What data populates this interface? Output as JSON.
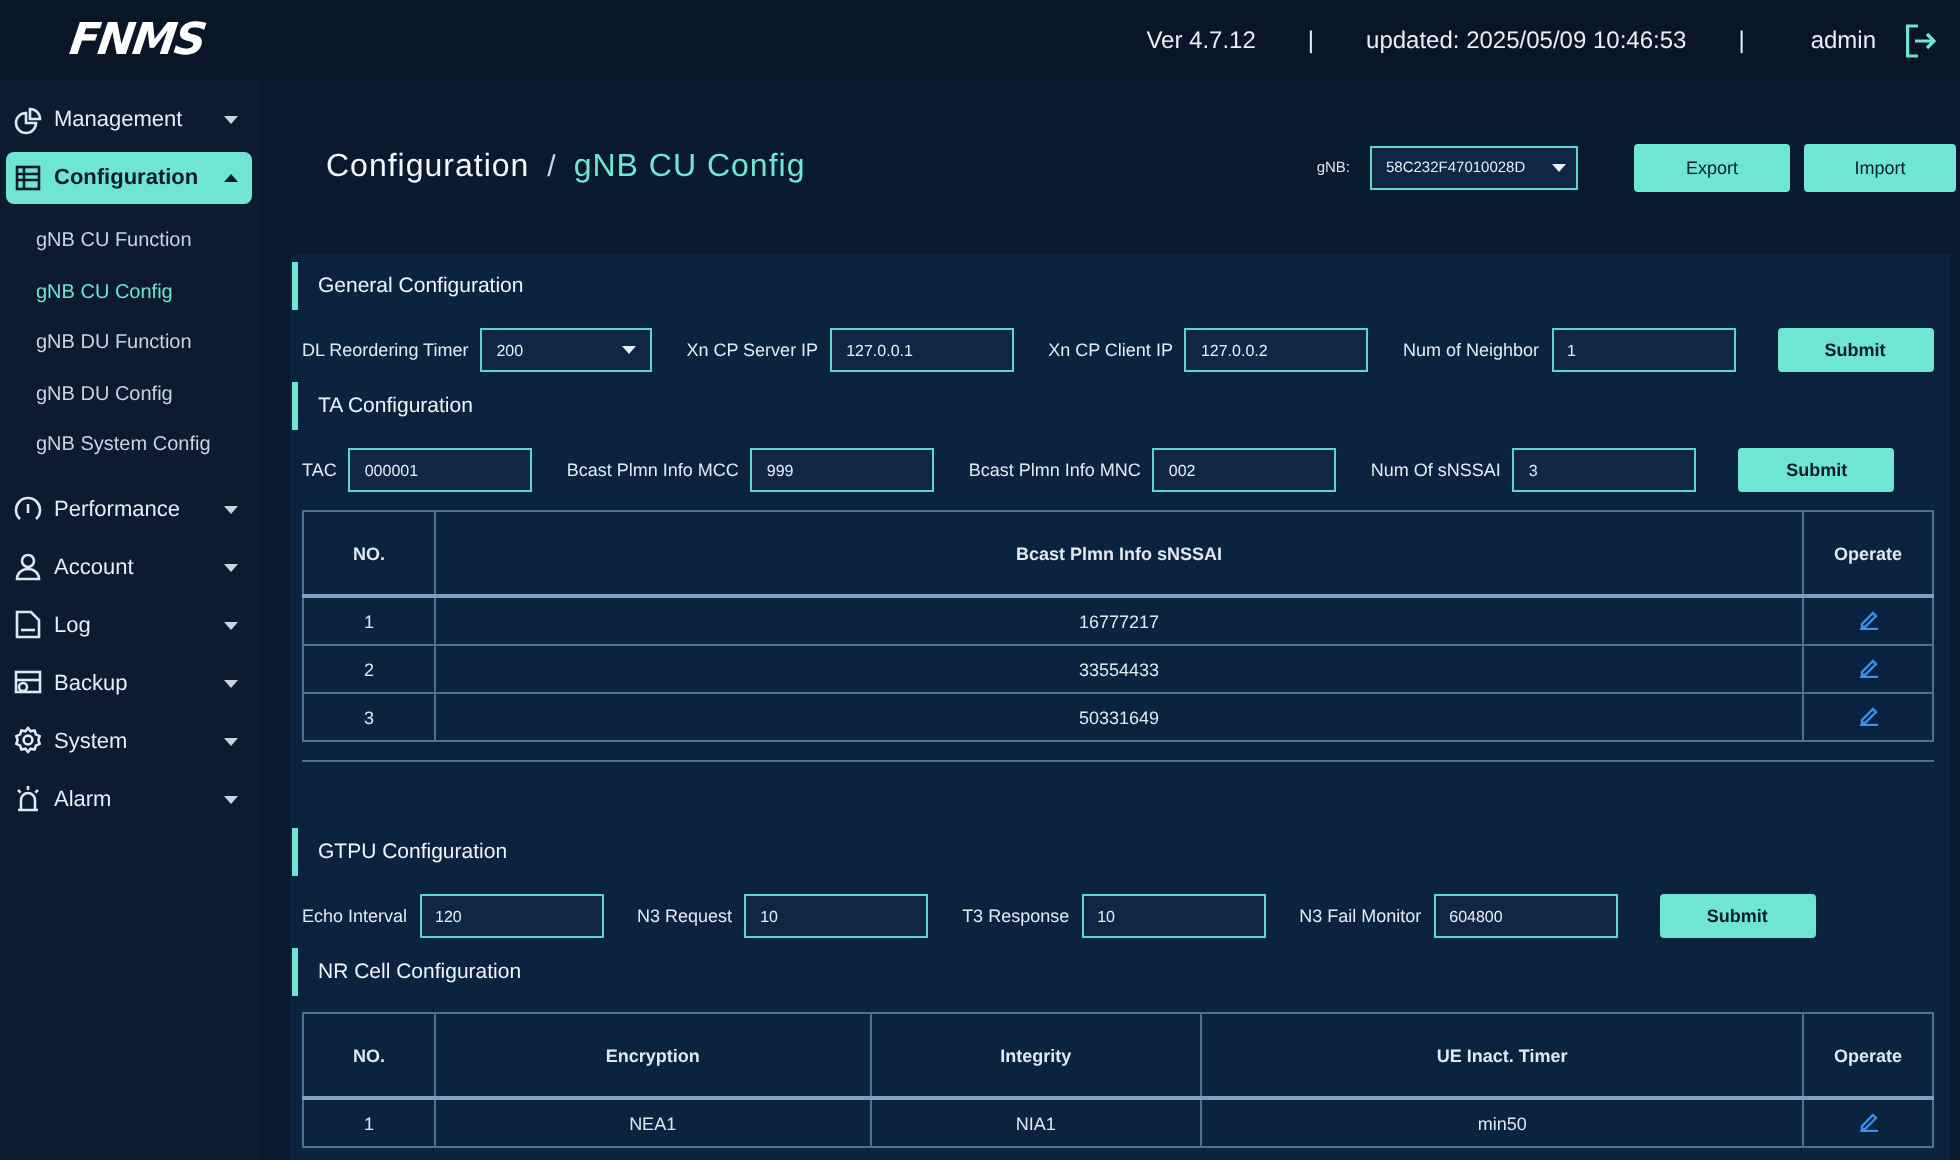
{
  "header": {
    "logo": "FNMS",
    "status_items": [
      {
        "kind": "text",
        "text": "Ver 4.7.12"
      },
      {
        "kind": "divider",
        "text": "|"
      },
      {
        "kind": "text",
        "text": "updated: 2025/05/09 10:46:53"
      },
      {
        "kind": "divider",
        "text": "|"
      },
      {
        "kind": "user",
        "text": "admin"
      }
    ]
  },
  "sidebar": {
    "items": [
      {
        "label": "Management",
        "selected": false,
        "expanded": false
      },
      {
        "label": "Configuration",
        "selected": true,
        "expanded": true,
        "children": [
          {
            "label": "gNB CU Function",
            "selected": false
          },
          {
            "label": "gNB CU Config",
            "selected": true
          },
          {
            "label": "gNB DU Function",
            "selected": false
          },
          {
            "label": "gNB DU Config",
            "selected": false
          },
          {
            "label": "gNB System Config",
            "selected": false
          }
        ]
      },
      {
        "label": "Performance",
        "selected": false,
        "expanded": false
      },
      {
        "label": "Account",
        "selected": false,
        "expanded": false
      },
      {
        "label": "Log",
        "selected": false,
        "expanded": false
      },
      {
        "label": "Backup",
        "selected": false,
        "expanded": false
      },
      {
        "label": "System",
        "selected": false,
        "expanded": false
      },
      {
        "label": "Alarm",
        "selected": false,
        "expanded": false
      }
    ]
  },
  "page": {
    "breadcrumb": [
      "Configuration",
      "gNB CU Config"
    ],
    "breadcrumb_separator": "/",
    "gnb_select": {
      "label": "gNB:",
      "value": "58C232F47010028D"
    },
    "buttons": [
      "Export",
      "Import"
    ]
  },
  "sections": [
    {
      "title": "General Configuration",
      "submit": "Submit",
      "fields": [
        {
          "kind": "select",
          "label": "DL Reordering Timer",
          "value": "200"
        },
        {
          "kind": "input",
          "label": "Xn CP Server IP",
          "value": "127.0.0.1"
        },
        {
          "kind": "input",
          "label": "Xn CP Client IP",
          "value": "127.0.0.2"
        },
        {
          "kind": "input",
          "label": "Num of Neighbor",
          "value": "1"
        }
      ]
    },
    {
      "title": "TA Configuration",
      "submit": "Submit",
      "fields": [
        {
          "kind": "input",
          "label": "TAC",
          "value": "000001"
        },
        {
          "kind": "input",
          "label": "Bcast Plmn Info MCC",
          "value": "999"
        },
        {
          "kind": "input",
          "label": "Bcast Plmn Info MNC",
          "value": "002"
        },
        {
          "kind": "input",
          "label": "Num Of sNSSAI",
          "value": "3"
        }
      ],
      "table": {
        "columns": [
          "NO.",
          "Bcast Plmn Info sNSSAI",
          "Operate"
        ],
        "rows": [
          {
            "cells": [
              "1",
              "16777217"
            ]
          },
          {
            "cells": [
              "2",
              "33554433"
            ]
          },
          {
            "cells": [
              "3",
              "50331649"
            ]
          }
        ]
      }
    },
    {
      "title": "GTPU Configuration",
      "submit": "Submit",
      "fields": [
        {
          "kind": "input",
          "label": "Echo Interval",
          "value": "120"
        },
        {
          "kind": "input",
          "label": "N3 Request",
          "value": "10"
        },
        {
          "kind": "input",
          "label": "T3 Response",
          "value": "10"
        },
        {
          "kind": "input",
          "label": "N3 Fail Monitor",
          "value": "604800"
        }
      ]
    },
    {
      "title": "NR Cell Configuration",
      "table": {
        "columns": [
          "NO.",
          "Encryption",
          "Integrity",
          "UE Inact. Timer",
          "Operate"
        ],
        "rows": [
          {
            "cells": [
              "1",
              "NEA1",
              "NIA1",
              "min50"
            ]
          }
        ]
      }
    }
  ]
}
